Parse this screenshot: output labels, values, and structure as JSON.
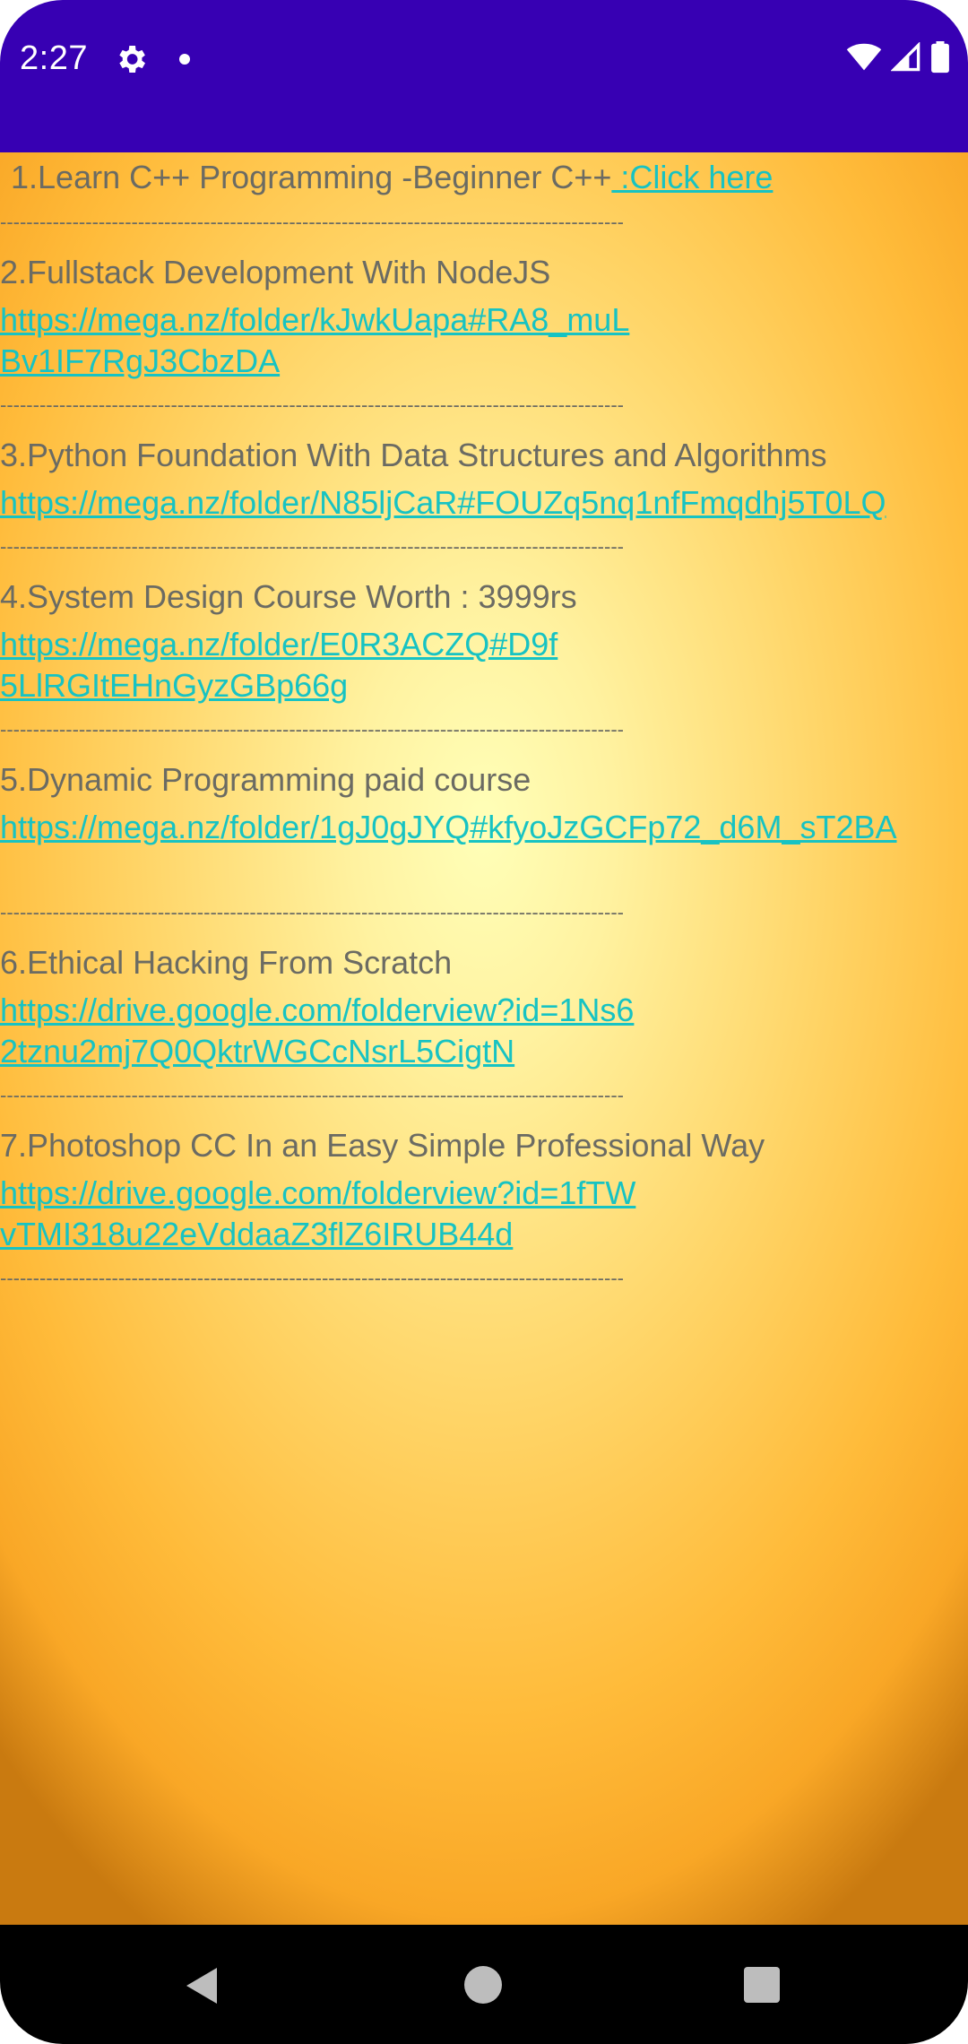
{
  "status_bar": {
    "time": "2:27",
    "icons": [
      "gear-icon",
      "notification-dot-icon",
      "wifi-icon",
      "signal-icon",
      "battery-icon"
    ],
    "background": "#3700b3"
  },
  "courses": [
    {
      "title": "1.Learn C++ Programming -Beginner C++",
      "link": " :Click here",
      "inline": true
    },
    {
      "title": "2.Fullstack Development With NodeJS",
      "link": "https://mega.nz/folder/kJwkUapa#RA8_muLBv1IF7RgJ3CbzDA"
    },
    {
      "title": "3.Python Foundation With Data Structures and Algorithms",
      "link": "https://mega.nz/folder/N85ljCaR#FOUZq5nq1nfFmqdhj5T0LQ"
    },
    {
      "title": "4.System Design Course Worth : 3999rs",
      "link": "https://mega.nz/folder/E0R3ACZQ#D9f5LlRGItEHnGyzGBp66g"
    },
    {
      "title": "5.Dynamic Programming paid course",
      "link": "https://mega.nz/folder/1gJ0gJYQ#kfyoJzGCFp72_d6M_sT2BA"
    },
    {
      "title": "6.Ethical Hacking From Scratch",
      "link": "https://drive.google.com/folderview?id=1Ns62tznu2mj7Q0QktrWGCcNsrL5CigtN"
    },
    {
      "title": "7.Photoshop CC In an Easy Simple Professional Way",
      "link": "https://drive.google.com/folderview?id=1fTWvTMI318u22eVddaaZ3flZ6IRUB44d"
    }
  ],
  "divider": "-----------------------------------------------------------------------------------------------",
  "colors": {
    "link": "#17c3c3",
    "text": "#6b6b63"
  },
  "nav_bar": {
    "icons": [
      "back-icon",
      "home-icon",
      "recents-icon"
    ]
  }
}
